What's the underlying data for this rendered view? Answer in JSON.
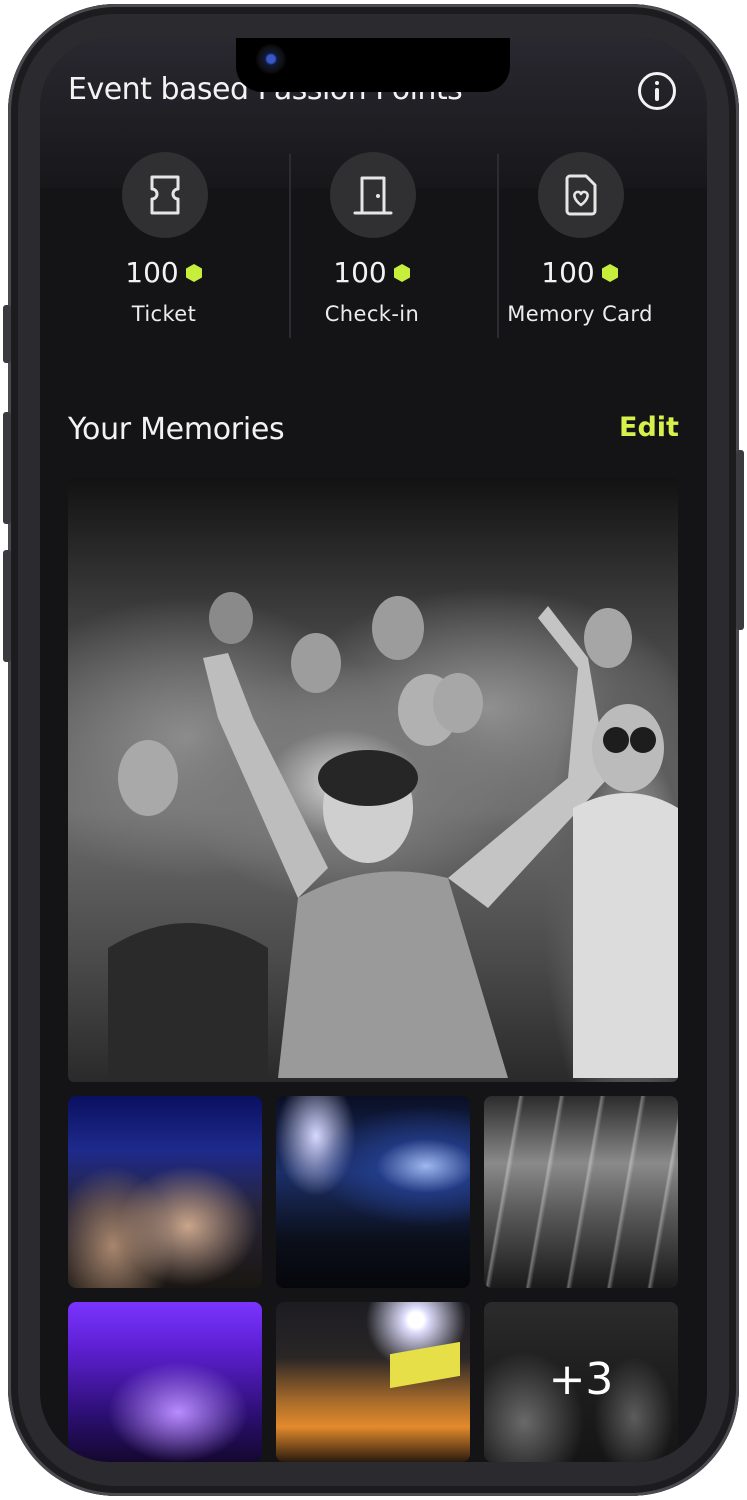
{
  "header": {
    "title": "Event based Passion Points",
    "info_icon": "info-circle-icon"
  },
  "points": [
    {
      "icon": "ticket-icon",
      "value": "100",
      "label": "Ticket"
    },
    {
      "icon": "door-icon",
      "value": "100",
      "label": "Check-in"
    },
    {
      "icon": "heart-card-icon",
      "value": "100",
      "label": "Memory Card"
    }
  ],
  "points_token_color": "#c6ee3a",
  "memories": {
    "title": "Your Memories",
    "edit_label": "Edit",
    "edit_color": "#d6f04c",
    "more_count": "+3"
  }
}
